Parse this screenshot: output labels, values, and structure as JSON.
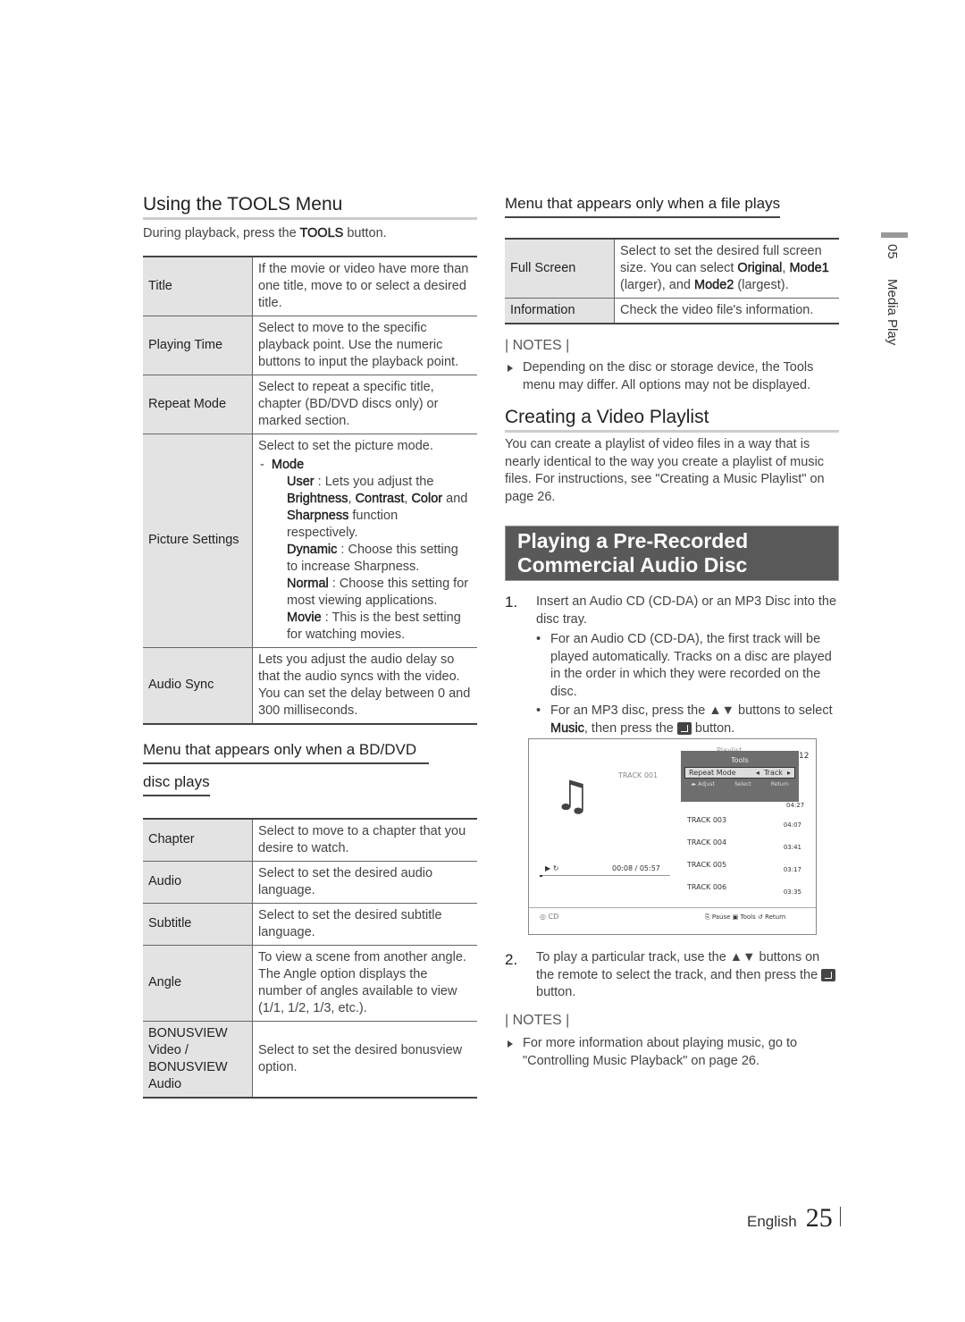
{
  "left": {
    "title": "Using the TOOLS Menu",
    "intro": [
      {
        "t": "During playback, press the "
      },
      {
        "t": "TOOLS",
        "b": 1
      },
      {
        "t": " button."
      }
    ],
    "tools_table": [
      {
        "label": "Title",
        "desc": [
          {
            "t": "If the movie or video have more than one title, move to or select a desired title."
          }
        ]
      },
      {
        "label": "Playing Time",
        "desc": [
          {
            "t": "Select to move to the specific playback point. Use the numeric buttons to input the playback point."
          }
        ]
      },
      {
        "label": "Repeat Mode",
        "desc": [
          {
            "t": "Select to repeat a specific title, chapter (BD/DVD discs only) or marked section."
          }
        ]
      },
      {
        "label": "Picture Settings",
        "desc": [
          {
            "t": "Select to set the picture mode."
          }
        ],
        "mode_label": "Mode",
        "modes": [
          [
            {
              "t": "User",
              "b": 1
            },
            {
              "t": " : Lets you adjust the "
            },
            {
              "t": "Brightness",
              "b": 1
            },
            {
              "t": ", "
            },
            {
              "t": "Contrast",
              "b": 1
            },
            {
              "t": ", "
            },
            {
              "t": "Color",
              "b": 1
            },
            {
              "t": " and "
            },
            {
              "t": "Sharpness",
              "b": 1
            },
            {
              "t": " function respectively."
            }
          ],
          [
            {
              "t": "Dynamic",
              "b": 1
            },
            {
              "t": " : Choose this setting to increase Sharpness."
            }
          ],
          [
            {
              "t": "Normal",
              "b": 1
            },
            {
              "t": " : Choose this setting for most viewing applications."
            }
          ],
          [
            {
              "t": "Movie",
              "b": 1
            },
            {
              "t": " : This is the best setting for watching movies."
            }
          ]
        ]
      },
      {
        "label": "Audio Sync",
        "desc": [
          {
            "t": "Lets you adjust the audio delay so that the audio syncs with the video. You can set the delay between 0 and 300 milliseconds."
          }
        ]
      }
    ],
    "bd_heading_1": "Menu that appears only when a BD/DVD",
    "bd_heading_2": "disc plays",
    "bd_table": [
      {
        "label": "Chapter",
        "desc": [
          {
            "t": "Select to move to a chapter that you desire to watch."
          }
        ]
      },
      {
        "label": "Audio",
        "desc": [
          {
            "t": "Select to set the desired audio language."
          }
        ]
      },
      {
        "label": "Subtitle",
        "desc": [
          {
            "t": "Select to set the desired subtitle language."
          }
        ]
      },
      {
        "label": "Angle",
        "desc": [
          {
            "t": "To view a scene from another angle. The Angle option displays the number of angles available to view (1/1, 1/2, 1/3, etc.)."
          }
        ]
      },
      {
        "label": "BONUSVIEW Video / BONUSVIEW Audio",
        "desc": [
          {
            "t": "Select to set the desired bonusview option."
          }
        ]
      }
    ]
  },
  "right": {
    "file_heading": "Menu that appears only when a file plays",
    "file_table": [
      {
        "label": "Full Screen",
        "desc": [
          {
            "t": "Select to set the desired full screen size. You can select "
          },
          {
            "t": "Original",
            "b": 1
          },
          {
            "t": ", "
          },
          {
            "t": "Mode1",
            "b": 1
          },
          {
            "t": " (larger), and "
          },
          {
            "t": "Mode2",
            "b": 1
          },
          {
            "t": " (largest)."
          }
        ]
      },
      {
        "label": "Information",
        "desc": [
          {
            "t": "Check the video file's information."
          }
        ]
      }
    ],
    "notes_label": "| NOTES |",
    "note1": "Depending on the disc or storage device, the Tools menu may differ. All options may not be displayed.",
    "playlist_title": "Creating a Video Playlist",
    "playlist_text": "You can create a playlist of video files in a way that is nearly identical to the way you create a playlist of music files. For instructions, see \"Creating a Music Playlist\" on page 26.",
    "banner_line1": "Playing a Pre-Recorded",
    "banner_line2": "Commercial Audio Disc",
    "step1_num": "1.",
    "step1": "Insert an Audio CD (CD-DA) or an MP3 Disc into the disc tray.",
    "bullet1": "For an Audio CD (CD-DA), the first track will be played automatically. Tracks on a disc are played in the order in which they were recorded on the disc.",
    "bullet2": [
      {
        "t": "For an MP3 disc, press the ▲▼ buttons to select "
      },
      {
        "t": "Music",
        "b": 1
      },
      {
        "t": ", then press the "
      }
    ],
    "bullet2_end": " button.",
    "screen": {
      "playlist": "Playlist",
      "count": "12",
      "current_track": "TRACK 001",
      "tools_title": "Tools",
      "repeat_mode": "Repeat Mode",
      "repeat_value": "Track",
      "adjust": "◂▸ Adjust",
      "select": "Select",
      "return": "Return",
      "hidden_time": "04:27",
      "tracks": [
        {
          "name": "TRACK 003",
          "time": "04:07"
        },
        {
          "name": "TRACK 004",
          "time": "03:41"
        },
        {
          "name": "TRACK 005",
          "time": "03:17"
        },
        {
          "name": "TRACK 006",
          "time": "03:35"
        }
      ],
      "elapsed": "00:08 / 05:57",
      "source": "CD",
      "pause": "Pause",
      "tools": "Tools",
      "return_btn": "Return",
      "progress": 0.02
    },
    "step2_num": "2.",
    "step2": "To play a particular track, use the ▲▼ buttons on the remote to select the track, and then press the ",
    "step2_end": " button.",
    "notes_label2": "| NOTES |",
    "note2": "For more information about playing music, go to \"Controlling Music Playback\" on page 26."
  },
  "side_tab": {
    "num": "05",
    "label": "Media Play"
  },
  "footer": {
    "lang": "English",
    "page": "25"
  }
}
